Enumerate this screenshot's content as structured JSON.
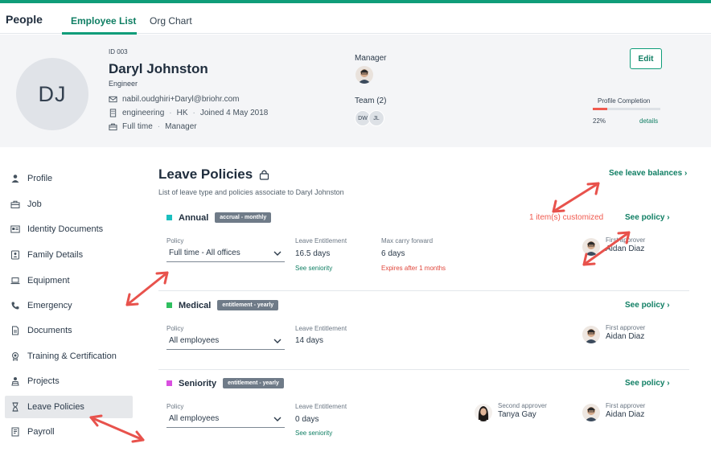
{
  "app": {
    "title": "People"
  },
  "tabs": [
    {
      "label": "Employee List",
      "active": true
    },
    {
      "label": "Org Chart",
      "active": false
    }
  ],
  "employee": {
    "initials": "DJ",
    "id": "ID 003",
    "name": "Daryl Johnston",
    "role": "Engineer",
    "email": "nabil.oudghiri+Daryl@briohr.com",
    "department": "engineering",
    "office": "HK",
    "joined": "Joined 4 May 2018",
    "employment_type": "Full time",
    "position": "Manager",
    "manager_label": "Manager",
    "team_label": "Team (2)",
    "team_members": [
      "DW",
      "JL"
    ],
    "edit_label": "Edit",
    "profile_completion_label": "Profile Completion",
    "profile_completion_percent": "22%",
    "profile_completion_value": 0.22,
    "details_label": "details"
  },
  "sidebar": {
    "items": [
      {
        "label": "Profile",
        "icon": "person-icon"
      },
      {
        "label": "Job",
        "icon": "briefcase-icon"
      },
      {
        "label": "Identity Documents",
        "icon": "id-card-icon"
      },
      {
        "label": "Family Details",
        "icon": "family-icon"
      },
      {
        "label": "Equipment",
        "icon": "laptop-icon"
      },
      {
        "label": "Emergency",
        "icon": "phone-icon"
      },
      {
        "label": "Documents",
        "icon": "document-icon"
      },
      {
        "label": "Training & Certification",
        "icon": "certificate-icon"
      },
      {
        "label": "Projects",
        "icon": "projects-icon"
      },
      {
        "label": "Leave Policies",
        "icon": "hourglass-icon",
        "active": true
      },
      {
        "label": "Payroll",
        "icon": "payroll-icon"
      }
    ]
  },
  "leave": {
    "title": "Leave Policies",
    "subtitle": "List of leave type and policies associate to Daryl Johnston",
    "see_balances": "See leave balances",
    "policies": [
      {
        "name": "Annual",
        "color": "#1bbfbf",
        "badge": "accrual - monthly",
        "customized": "1 item(s) customized",
        "see_policy": "See policy",
        "policy_label": "Policy",
        "policy_value": "Full time - All offices",
        "entitlement_label": "Leave Entitlement",
        "entitlement_value": "16.5 days",
        "see_seniority": "See seniority",
        "carry_label": "Max carry forward",
        "carry_value": "6 days",
        "carry_note": "Expires after 1 months",
        "first_approver_role": "First approver",
        "first_approver_name": "Aidan Diaz"
      },
      {
        "name": "Medical",
        "color": "#2fbf5f",
        "badge": "entitlement - yearly",
        "see_policy": "See policy",
        "policy_label": "Policy",
        "policy_value": "All employees",
        "entitlement_label": "Leave Entitlement",
        "entitlement_value": "14 days",
        "first_approver_role": "First approver",
        "first_approver_name": "Aidan Diaz"
      },
      {
        "name": "Seniority",
        "color": "#d94fe0",
        "badge": "entitlement - yearly",
        "see_policy": "See policy",
        "policy_label": "Policy",
        "policy_value": "All employees",
        "entitlement_label": "Leave Entitlement",
        "entitlement_value": "0 days",
        "see_seniority": "See seniority",
        "second_approver_role": "Second approver",
        "second_approver_name": "Tanya Gay",
        "first_approver_role": "First approver",
        "first_approver_name": "Aidan Diaz"
      }
    ]
  },
  "colors": {
    "accent": "#0f9d79",
    "warning": "#f05a4f",
    "annotation": "#e8524c"
  }
}
